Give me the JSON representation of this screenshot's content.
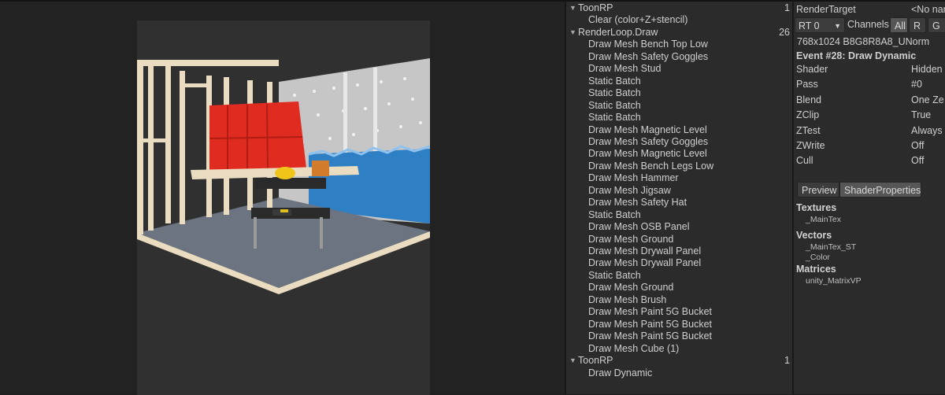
{
  "tree": {
    "groups": [
      {
        "label": "ToonRP",
        "count": "1",
        "children": [
          "Clear (color+Z+stencil)"
        ]
      },
      {
        "label": "RenderLoop.Draw",
        "count": "26",
        "children": [
          "Draw Mesh Bench Top Low",
          "Draw Mesh Safety Goggles",
          "Draw Mesh Stud",
          "Static Batch",
          "Static Batch",
          "Static Batch",
          "Static Batch",
          "Draw Mesh Magnetic Level",
          "Draw Mesh Safety Goggles",
          "Draw Mesh Magnetic Level",
          "Draw Mesh Bench Legs Low",
          "Draw Mesh Hammer",
          "Draw Mesh Jigsaw",
          "Draw Mesh Safety Hat",
          "Static Batch",
          "Draw Mesh OSB Panel",
          "Draw Mesh Ground",
          "Draw Mesh Drywall Panel",
          "Draw Mesh Drywall Panel",
          "Static Batch",
          "Draw Mesh Ground",
          "Draw Mesh Brush",
          "Draw Mesh Paint 5G Bucket",
          "Draw Mesh Paint 5G Bucket",
          "Draw Mesh Paint 5G Bucket",
          "Draw Mesh Cube (1)"
        ]
      },
      {
        "label": "ToonRP",
        "count": "1",
        "children": [
          "Draw Dynamic"
        ]
      }
    ]
  },
  "props": {
    "render_target_label": "RenderTarget",
    "render_target_value": "<No nar",
    "rt_select": "RT 0",
    "channels_label": "Channels",
    "channel_buttons": [
      "All",
      "R",
      "G"
    ],
    "format": "768x1024 B8G8R8A8_UNorm",
    "event_title": "Event #28: Draw Dynamic",
    "state": [
      {
        "k": "Shader",
        "v": "Hidden"
      },
      {
        "k": "Pass",
        "v": "#0"
      },
      {
        "k": "Blend",
        "v": "One Ze"
      },
      {
        "k": "ZClip",
        "v": "True"
      },
      {
        "k": "ZTest",
        "v": "Always"
      },
      {
        "k": "ZWrite",
        "v": "Off"
      },
      {
        "k": "Cull",
        "v": "Off"
      }
    ],
    "tabs": [
      "Preview",
      "ShaderProperties"
    ],
    "textures_title": "Textures",
    "textures": [
      "_MainTex"
    ],
    "vectors_title": "Vectors",
    "vectors": [
      "_MainTex_ST",
      "_Color"
    ],
    "matrices_title": "Matrices",
    "matrices": [
      "unity_MatrixVP"
    ]
  },
  "colors": {
    "accent_red": "#e02b20",
    "wall_blue": "#2f7fc4",
    "wood": "#e9dcc0",
    "floor": "#6b7480"
  }
}
